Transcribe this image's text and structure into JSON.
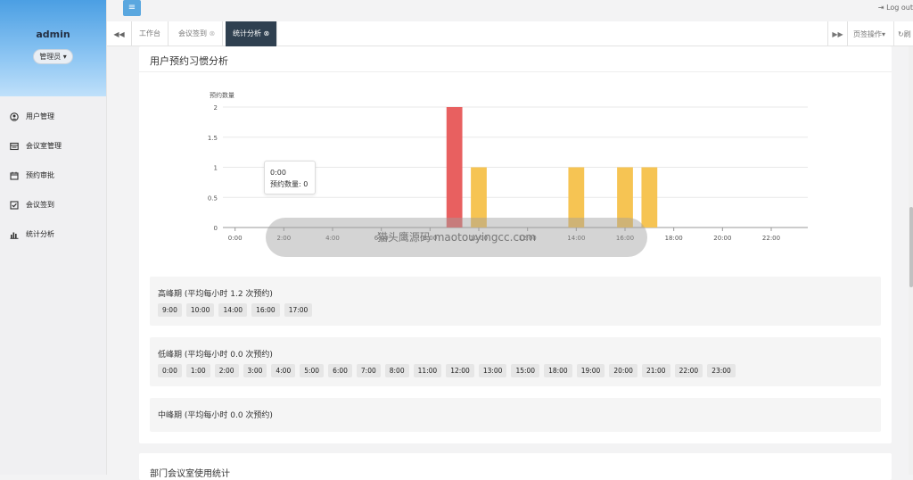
{
  "sidebar": {
    "username": "admin",
    "role_label": "管理员",
    "items": [
      {
        "label": "用户管理",
        "icon": "user-circle-icon"
      },
      {
        "label": "会议室管理",
        "icon": "list-icon"
      },
      {
        "label": "预约审批",
        "icon": "calendar-icon"
      },
      {
        "label": "会议签到",
        "icon": "check-square-icon"
      },
      {
        "label": "统计分析",
        "icon": "bar-chart-icon"
      }
    ]
  },
  "topbar": {
    "logout_label": "Log out"
  },
  "tabs": {
    "items": [
      {
        "label": "工作台"
      },
      {
        "label": "会议签到"
      },
      {
        "label": "统计分析"
      }
    ],
    "page_ops_label": "页签操作",
    "refresh_label": "刷"
  },
  "panel": {
    "title": "用户预约习惯分析"
  },
  "chart_data": {
    "type": "bar",
    "ylabel": "预约数量",
    "ylim": [
      0,
      2
    ],
    "yticks": [
      "0",
      "0.5",
      "1",
      "1.5",
      "2"
    ],
    "categories": [
      "0:00",
      "1:00",
      "2:00",
      "3:00",
      "4:00",
      "5:00",
      "6:00",
      "7:00",
      "8:00",
      "9:00",
      "10:00",
      "11:00",
      "12:00",
      "13:00",
      "14:00",
      "15:00",
      "16:00",
      "17:00",
      "18:00",
      "19:00",
      "20:00",
      "21:00",
      "22:00",
      "23:00"
    ],
    "xtick_labels": [
      "0:00",
      "2:00",
      "4:00",
      "6:00",
      "8:00",
      "10:00",
      "12:00",
      "14:00",
      "16:00",
      "18:00",
      "20:00",
      "22:00"
    ],
    "values": [
      0,
      0,
      0,
      0,
      0,
      0,
      0,
      0,
      0,
      2,
      1,
      0,
      0,
      0,
      1,
      0,
      1,
      1,
      0,
      0,
      0,
      0,
      0,
      0
    ],
    "colors": {
      "peak": "#e86060",
      "high": "#f6c453"
    }
  },
  "tooltip": {
    "time": "0:00",
    "line": "预约数量: 0"
  },
  "periods": [
    {
      "title": "高峰期 (平均每小时 1.2 次预约)",
      "chips": [
        "9:00",
        "10:00",
        "14:00",
        "16:00",
        "17:00"
      ]
    },
    {
      "title": "低峰期 (平均每小时 0.0 次预约)",
      "chips": [
        "0:00",
        "1:00",
        "2:00",
        "3:00",
        "4:00",
        "5:00",
        "6:00",
        "7:00",
        "8:00",
        "11:00",
        "12:00",
        "13:00",
        "15:00",
        "18:00",
        "19:00",
        "20:00",
        "21:00",
        "22:00",
        "23:00"
      ]
    },
    {
      "title": "中峰期 (平均每小时 0.0 次预约)",
      "chips": []
    }
  ],
  "watermark": {
    "text": "猫头鹰源码 maotouyingcc.com"
  },
  "bottom_panel": {
    "title": "部门会议室使用统计"
  }
}
